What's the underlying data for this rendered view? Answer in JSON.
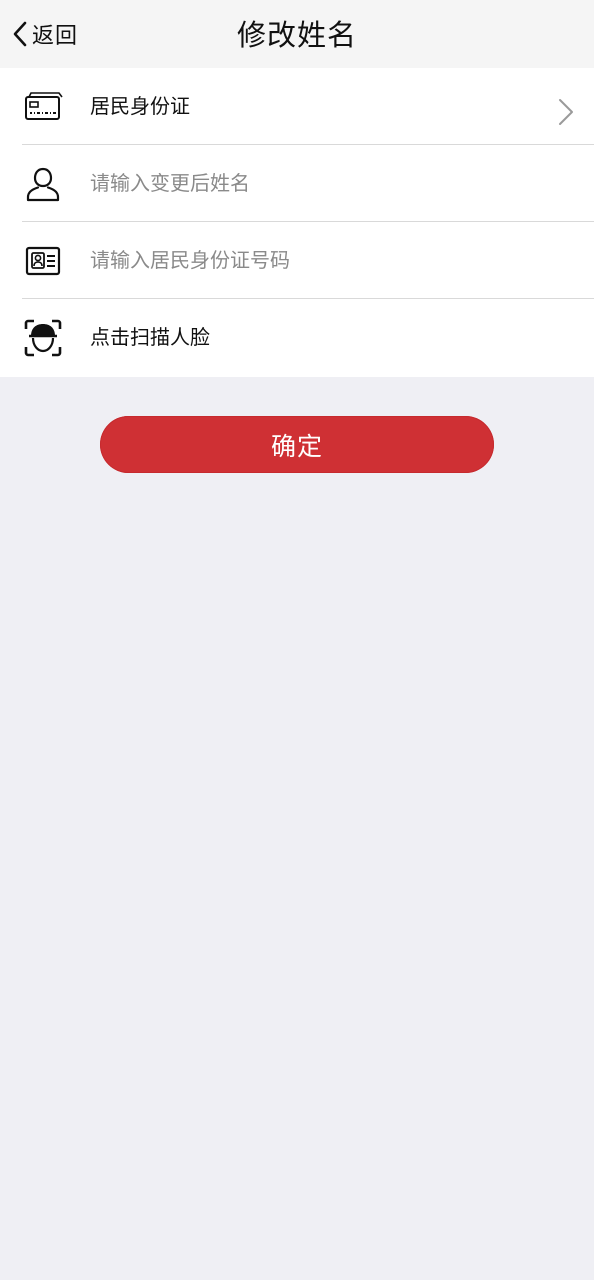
{
  "nav": {
    "back_label": "返回",
    "back_icon": "chevron-left-icon",
    "title": "修改姓名"
  },
  "form": {
    "id_type": {
      "icon": "id-card-icon",
      "label": "居民身份证",
      "trailing_icon": "chevron-right-icon"
    },
    "name": {
      "icon": "person-icon",
      "value": "",
      "placeholder": "请输入变更后姓名"
    },
    "id_number": {
      "icon": "contact-card-icon",
      "value": "",
      "placeholder": "请输入居民身份证号码"
    },
    "face_scan": {
      "icon": "face-scan-icon",
      "label": "点击扫描人脸"
    }
  },
  "confirm_label": "确定",
  "colors": {
    "accent": "#cf3034",
    "page_background": "#efeff4",
    "nav_background": "#f5f5f5",
    "divider": "#d9d9d9",
    "placeholder": "#8a8a8a"
  }
}
